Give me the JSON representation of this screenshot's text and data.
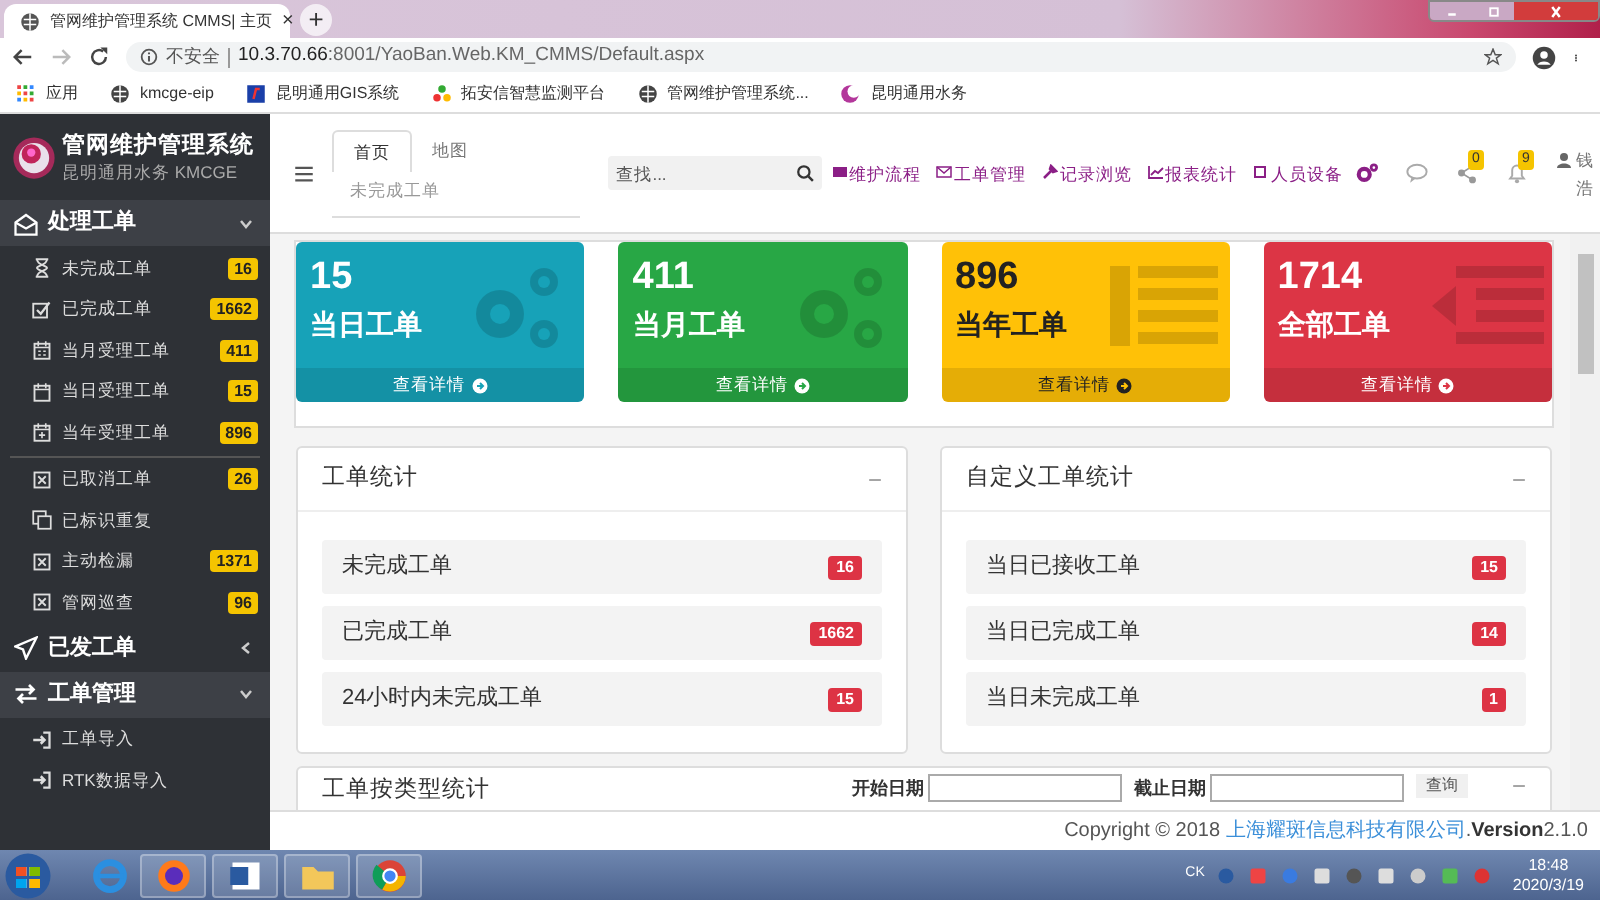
{
  "browser": {
    "tab": {
      "title": "管网维护管理系统 CMMS| 主页",
      "close": "×"
    },
    "new_tab": "+",
    "address": {
      "security": "不安全",
      "host": "10.3.70.66",
      "path": ":8001/YaoBan.Web.KM_CMMS/Default.aspx"
    },
    "bookmarks": [
      {
        "label": "应用"
      },
      {
        "label": "kmcge-eip"
      },
      {
        "label": "昆明通用GIS系统"
      },
      {
        "label": "拓安信智慧监测平台"
      },
      {
        "label": "管网维护管理系统..."
      },
      {
        "label": "昆明通用水务"
      }
    ]
  },
  "sidebar": {
    "title": "管网维护管理系统",
    "subtitle": "昆明通用水务 KMCGE",
    "sections": [
      {
        "label": "处理工单",
        "expanded": true,
        "groups": [
          [
            {
              "label": "未完成工单",
              "badge": "16"
            },
            {
              "label": "已完成工单",
              "badge": "1662"
            },
            {
              "label": "当月受理工单",
              "badge": "411"
            },
            {
              "label": "当日受理工单",
              "badge": "15"
            },
            {
              "label": "当年受理工单",
              "badge": "896"
            }
          ],
          [
            {
              "label": "已取消工单",
              "badge": "26"
            },
            {
              "label": "已标识重复"
            },
            {
              "label": "主动检漏",
              "badge": "1371"
            },
            {
              "label": "管网巡查",
              "badge": "96"
            }
          ]
        ]
      },
      {
        "label": "已发工单",
        "expanded": false
      },
      {
        "label": "工单管理",
        "expanded": true,
        "groups": [
          [
            {
              "label": "工单导入"
            },
            {
              "label": "RTK数据导入"
            }
          ]
        ]
      }
    ]
  },
  "header": {
    "tabs": [
      {
        "label": "首页",
        "selected": true
      },
      {
        "label": "地图",
        "selected": false
      }
    ],
    "subtab": "未完成工单",
    "search": {
      "placeholder": "查找..."
    },
    "nav": [
      "维护流程",
      "工单管理",
      "记录浏览",
      "报表统计",
      "人员设备"
    ],
    "share_badge": "0",
    "bell_badge": "9",
    "user": "钱浩"
  },
  "cards": [
    {
      "value": "15",
      "label": "当日工单",
      "link": "查看详情",
      "color": "#17a2b8"
    },
    {
      "value": "411",
      "label": "当月工单",
      "link": "查看详情",
      "color": "#28a745"
    },
    {
      "value": "896",
      "label": "当年工单",
      "link": "查看详情",
      "color": "#ffc107"
    },
    {
      "value": "1714",
      "label": "全部工单",
      "link": "查看详情",
      "color": "#dc3545"
    }
  ],
  "panels": [
    {
      "title": "工单统计",
      "collapse": "−",
      "rows": [
        {
          "label": "未完成工单",
          "count": "16"
        },
        {
          "label": "已完成工单",
          "count": "1662"
        },
        {
          "label": "24小时内未完成工单",
          "count": "15"
        }
      ]
    },
    {
      "title": "自定义工单统计",
      "collapse": "−",
      "rows": [
        {
          "label": "当日已接收工单",
          "count": "15"
        },
        {
          "label": "当日已完成工单",
          "count": "14"
        },
        {
          "label": "当日未完成工单",
          "count": "1"
        }
      ]
    }
  ],
  "type_panel": {
    "title": "工单按类型统计",
    "start_label": "开始日期",
    "end_label": "截止日期",
    "query": "查询",
    "collapse": "−"
  },
  "footer": {
    "copyright": "Copyright © 2018 ",
    "company": "上海耀斑信息科技有限公司",
    "dot": ".",
    "version_label": "Version",
    "version": "2.1.0"
  },
  "taskbar": {
    "ime": "CK",
    "time": "18:48",
    "date": "2020/3/19"
  }
}
